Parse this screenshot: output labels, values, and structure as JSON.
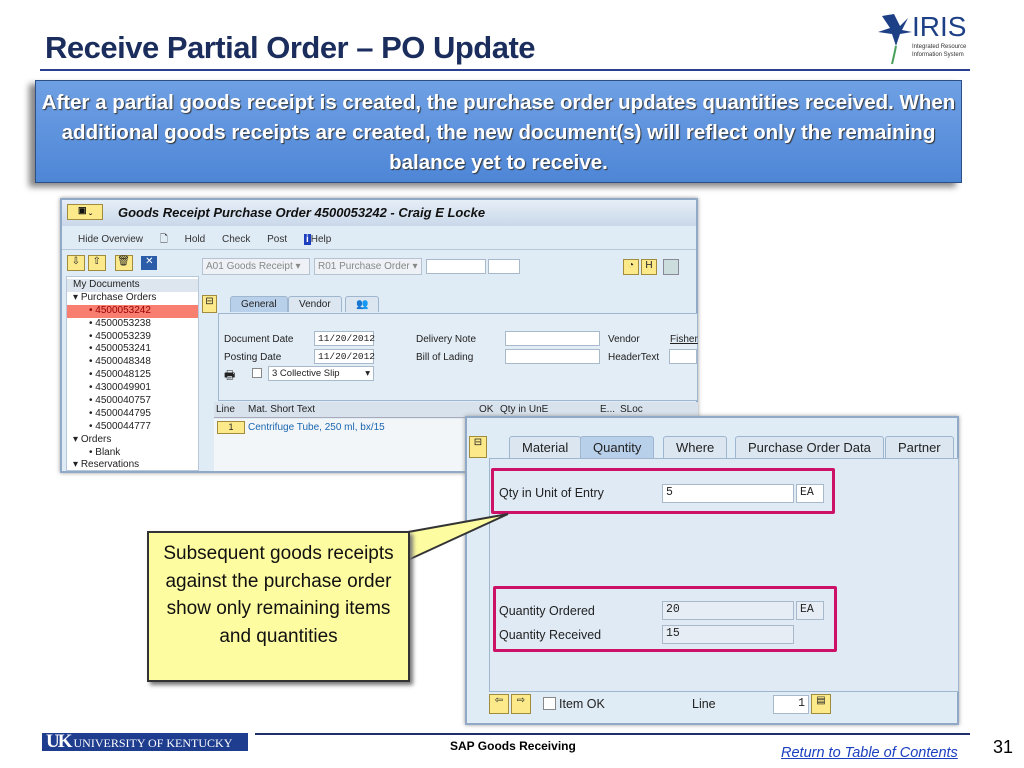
{
  "slide": {
    "title": "Receive Partial Order – PO Update",
    "banner": "After a partial goods receipt is created, the purchase order updates quantities received. When additional goods receipts are created, the new document(s) will reflect only the remaining balance yet to receive.",
    "logo": "IRIS Integrated Resource Information System",
    "callout": "Subsequent goods receipts against the purchase order show only remaining items and quantities"
  },
  "sap1": {
    "title": "Goods Receipt Purchase Order 4500053242 - Craig E Locke",
    "toolbar": {
      "hide_overview": "Hide Overview",
      "hold": "Hold",
      "check": "Check",
      "post": "Post",
      "help": "Help"
    },
    "tree": {
      "header": "My Documents",
      "purchase_orders": "Purchase Orders",
      "items": [
        "4500053242",
        "4500053238",
        "4500053239",
        "4500053241",
        "4500048348",
        "4500048125",
        "4300049901",
        "4500040757",
        "4500044795",
        "4500044777"
      ],
      "orders": "Orders",
      "blank": "Blank",
      "reservations": "Reservations"
    },
    "action": "A01 Goods Receipt",
    "reference": "R01 Purchase Order",
    "tabs": [
      "General",
      "Vendor"
    ],
    "document_date_label": "Document Date",
    "document_date": "11/20/2012",
    "posting_date_label": "Posting Date",
    "posting_date": "11/20/2012",
    "delivery_note_label": "Delivery Note",
    "bill_of_lading_label": "Bill of Lading",
    "vendor_label": "Vendor",
    "vendor": "Fisher",
    "header_text_label": "HeaderText",
    "slip": "3 Collective Slip",
    "columns": [
      "Line",
      "Mat. Short Text",
      "OK",
      "Qty in UnE",
      "E...",
      "SLoc"
    ],
    "row": {
      "line": "1",
      "text": "Centrifuge Tube, 250 ml, bx/15"
    }
  },
  "sap2": {
    "tabs": [
      "Material",
      "Quantity",
      "Where",
      "Purchase Order Data",
      "Partner"
    ],
    "active_tab": "Quantity",
    "qty_entry_label": "Qty in Unit of Entry",
    "qty_entry": "5",
    "unit": "EA",
    "qty_ordered_label": "Quantity Ordered",
    "qty_ordered": "20",
    "qty_received_label": "Quantity Received",
    "qty_received": "15",
    "item_ok": "Item OK",
    "line_label": "Line",
    "line": "1"
  },
  "footer": {
    "uk_logo": "UK UNIVERSITY OF KENTUCKY",
    "title": "SAP Goods Receiving",
    "toc": "Return to Table of Contents",
    "page": "31"
  },
  "colors": {
    "title": "#1b2d5c",
    "banner": "#5b8fd6",
    "highlight": "#cc1166",
    "callout": "#fdfca0"
  }
}
